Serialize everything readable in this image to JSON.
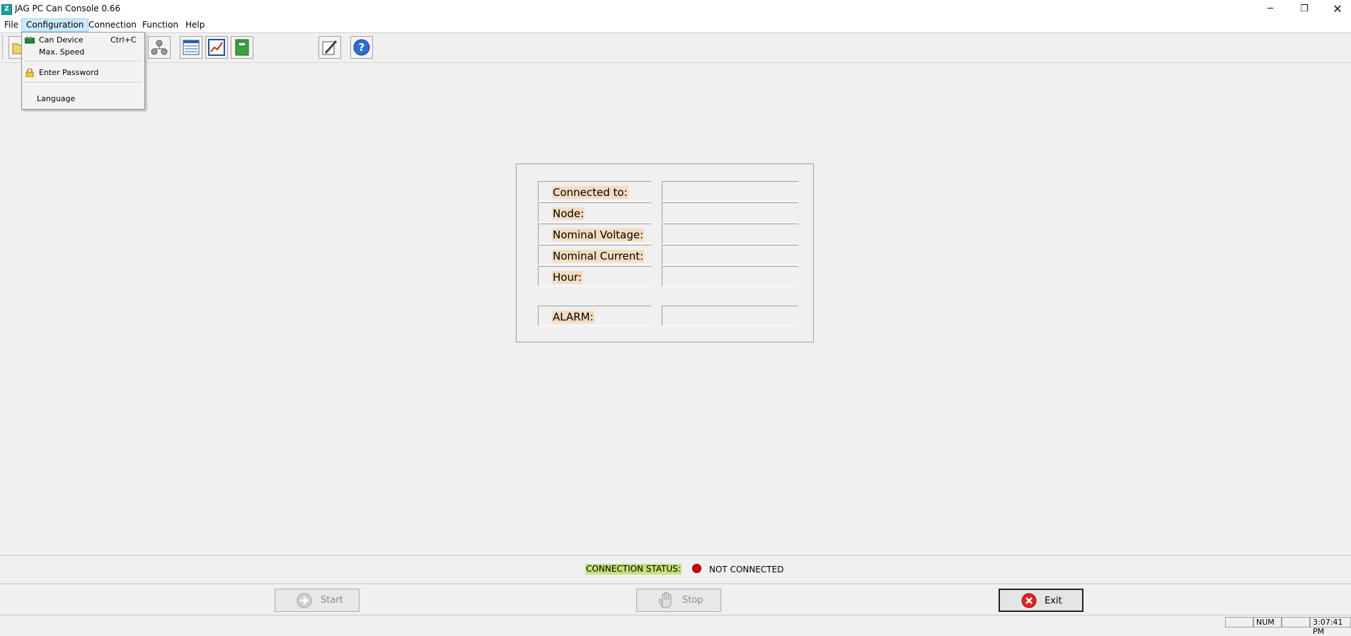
{
  "window": {
    "title": "JAG PC Can Console 0.66",
    "icon": "app-logo-icon",
    "minimize_glyph": "─",
    "maximize_glyph": "❐",
    "close_glyph": "✕"
  },
  "menubar": {
    "items": [
      "File",
      "Configuration",
      "Connection",
      "Function",
      "Help"
    ]
  },
  "config_menu": {
    "can_device": "Can Device",
    "can_device_shortcut": "Ctrl+C",
    "max_speed": "Max. Speed",
    "enter_password": "Enter Password",
    "language": "Language"
  },
  "toolbar": {
    "icons": [
      "open-folder-icon",
      "network-nodes-icon",
      "list-window-icon",
      "chart-icon",
      "green-book-icon",
      "edit-pencil-icon",
      "help-icon"
    ]
  },
  "info": {
    "connected_to_label": "Connected to:",
    "connected_to_value": "",
    "node_label": "Node:",
    "node_value": "",
    "nominal_voltage_label": "Nominal Voltage:",
    "nominal_voltage_value": "",
    "nominal_current_label": "Nominal Current:",
    "nominal_current_value": "",
    "hour_label": "Hour:",
    "hour_value": "",
    "alarm_label": "ALARM:",
    "alarm_value": ""
  },
  "connection": {
    "status_label": "CONNECTION STATUS:",
    "status_text": "NOT CONNECTED",
    "status_color": "#d40000",
    "label_highlight": "#c6e07a"
  },
  "buttons": {
    "start": "Start",
    "stop": "Stop",
    "exit": "Exit"
  },
  "statusbar": {
    "num": "NUM",
    "time": "3:07:41 PM"
  },
  "colors": {
    "label_highlight": "#f5dcc1",
    "menu_active": "#cce8ff"
  }
}
